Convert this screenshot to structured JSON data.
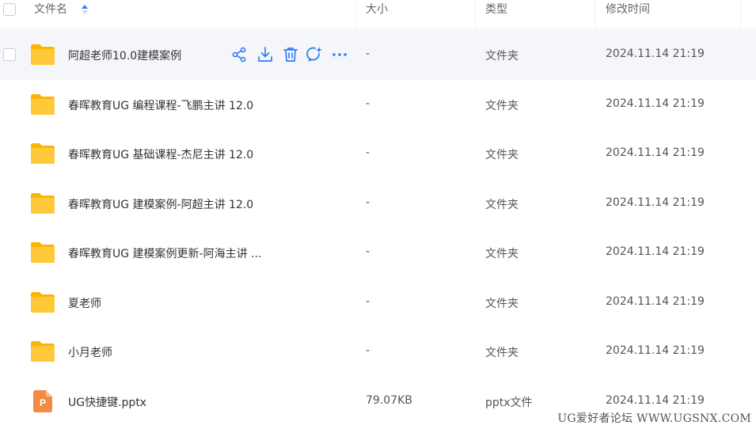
{
  "header": {
    "name_label": "文件名",
    "size_label": "大小",
    "type_label": "类型",
    "time_label": "修改时间"
  },
  "rows": [
    {
      "name": "阿超老师10.0建模案例",
      "size": "-",
      "type": "文件夹",
      "time": "2024.11.14 21:19",
      "icon": "folder-icon",
      "hover": true
    },
    {
      "name": "春晖教育UG 编程课程-飞鹏主讲 12.0",
      "size": "-",
      "type": "文件夹",
      "time": "2024.11.14 21:19",
      "icon": "folder-icon"
    },
    {
      "name": "春晖教育UG 基础课程-杰尼主讲 12.0",
      "size": "-",
      "type": "文件夹",
      "time": "2024.11.14 21:19",
      "icon": "folder-icon"
    },
    {
      "name": "春晖教育UG 建模案例-阿超主讲 12.0",
      "size": "-",
      "type": "文件夹",
      "time": "2024.11.14 21:19",
      "icon": "folder-icon"
    },
    {
      "name": "春晖教育UG 建模案例更新-阿海主讲 ...",
      "size": "-",
      "type": "文件夹",
      "time": "2024.11.14 21:19",
      "icon": "folder-icon"
    },
    {
      "name": "夏老师",
      "size": "-",
      "type": "文件夹",
      "time": "2024.11.14 21:19",
      "icon": "folder-icon"
    },
    {
      "name": "小月老师",
      "size": "-",
      "type": "文件夹",
      "time": "2024.11.14 21:19",
      "icon": "folder-icon"
    },
    {
      "name": "UG快捷键.pptx",
      "size": "79.07KB",
      "type": "pptx文件",
      "time": "2024.11.14 21:19",
      "icon": "pptx-file-icon"
    }
  ],
  "row_actions": [
    "share-icon",
    "download-icon",
    "delete-icon",
    "ai-chat-icon",
    "more-icon"
  ],
  "pptx_badge": "P",
  "watermark": "UG爱好者论坛 WWW.UGSNX.COM",
  "colors": {
    "accent": "#2f7cf6",
    "folder": "#ffc93c",
    "pptx": "#f58a45",
    "hover_row": "#f5f6f9"
  }
}
